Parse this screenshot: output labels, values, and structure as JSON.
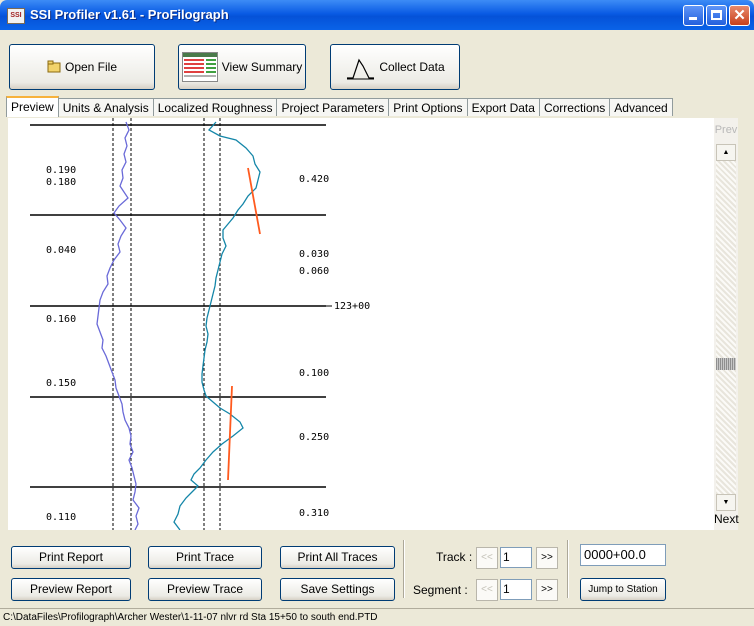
{
  "window": {
    "title": "SSI Profiler v1.61 - ProFilograph",
    "app_icon_text": "SSI"
  },
  "toolbar": {
    "open_label": "Open File",
    "summary_label": "View Summary",
    "collect_label": "Collect Data"
  },
  "tabs": [
    "Preview",
    "Units & Analysis",
    "Localized Roughness",
    "Project Parameters",
    "Print Options",
    "Export Data",
    "Corrections",
    "Advanced"
  ],
  "preview": {
    "left_values": [
      "0.190",
      "0.180",
      "0.040",
      "0.160",
      "0.150",
      "0.110"
    ],
    "right_values": [
      "0.420",
      "0.030",
      "0.060",
      "0.100",
      "0.250",
      "0.310"
    ],
    "station_marker": "123+00",
    "trace_colors": {
      "left": "#6a6ad8",
      "right": "#1486a8",
      "highlight": "#ff5a1e"
    }
  },
  "scroll": {
    "prev_label": "Prev",
    "next_label": "Next"
  },
  "bottom": {
    "print_report": "Print Report",
    "print_trace": "Print Trace",
    "print_all": "Print All Traces",
    "preview_report": "Preview Report",
    "preview_trace": "Preview Trace",
    "save_settings": "Save Settings",
    "track_label": "Track :",
    "segment_label": "Segment :",
    "prev_spin": "<<",
    "next_spin": ">>",
    "track_value": "1",
    "segment_value": "1",
    "station_value": "0000+00.0",
    "jump_label": "Jump to Station"
  },
  "status": {
    "path": "C:\\DataFiles\\Profilograph\\Archer Wester\\1-11-07 nlvr rd Sta 15+50 to south end.PTD"
  }
}
